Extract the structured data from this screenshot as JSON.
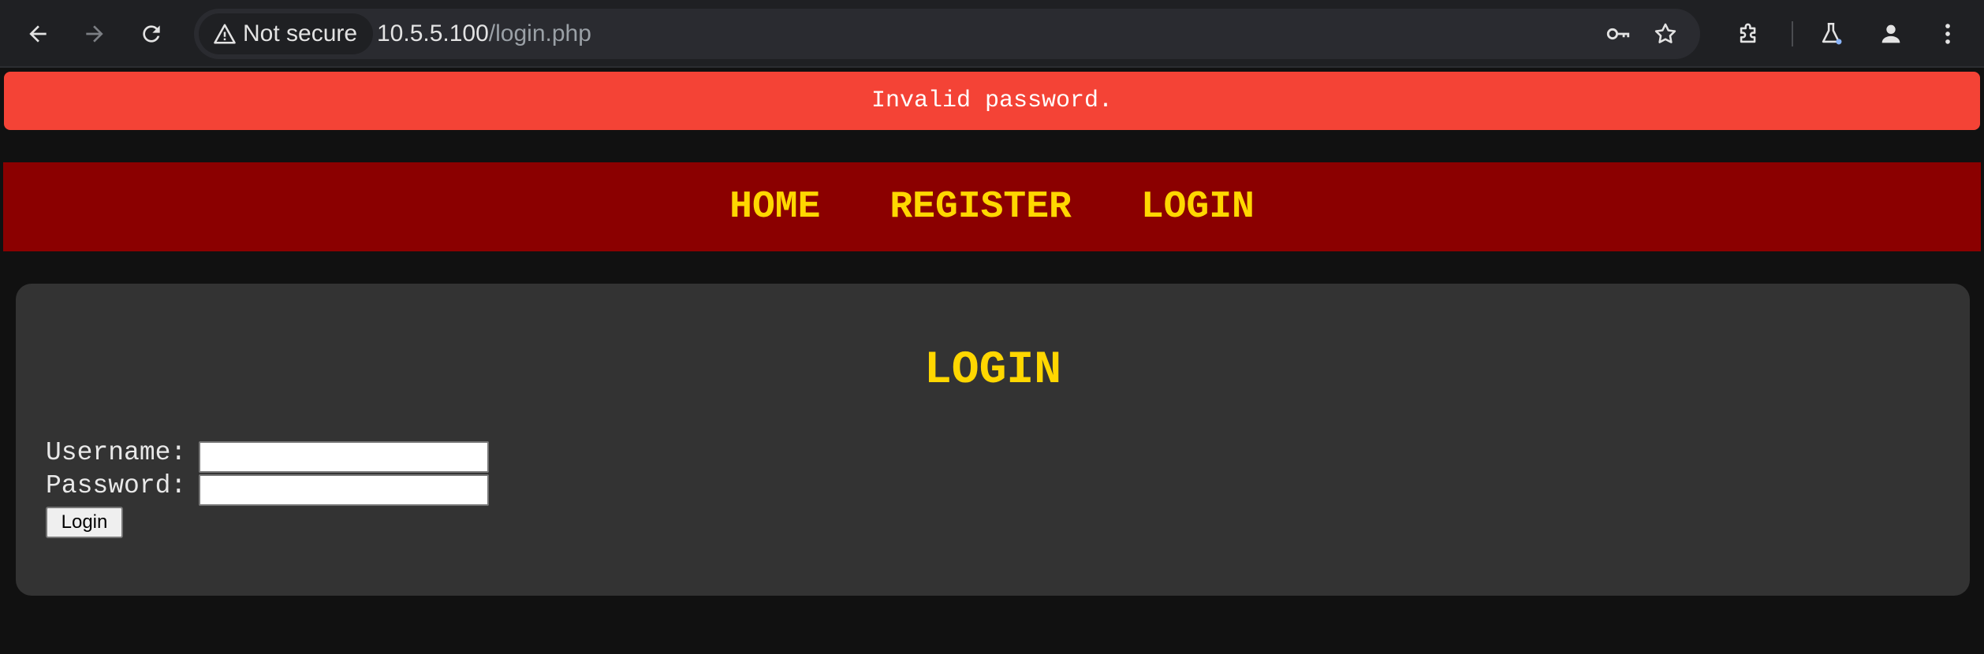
{
  "browser": {
    "security_label": "Not secure",
    "url_host": "10.5.5.100",
    "url_path": "/login.php"
  },
  "alert": {
    "message": "Invalid password."
  },
  "nav": {
    "items": [
      {
        "label": "HOME"
      },
      {
        "label": "REGISTER"
      },
      {
        "label": "LOGIN"
      }
    ]
  },
  "login_form": {
    "title": "LOGIN",
    "username_label": "Username:",
    "username_value": "",
    "password_label": "Password:",
    "password_value": "",
    "submit_label": "Login"
  },
  "colors": {
    "alert_bg": "#f44336",
    "nav_bg": "#8b0000",
    "accent_text": "#ffd700",
    "panel_bg": "#333333",
    "page_bg": "#111111"
  },
  "icons": {
    "back": "arrow-left-icon",
    "forward": "arrow-right-icon",
    "reload": "reload-icon",
    "security": "warning-triangle-icon",
    "password_manager": "key-icon",
    "bookmark": "star-icon",
    "extensions": "puzzle-icon",
    "labs": "flask-icon",
    "profile": "person-icon",
    "menu": "kebab-menu-icon"
  }
}
